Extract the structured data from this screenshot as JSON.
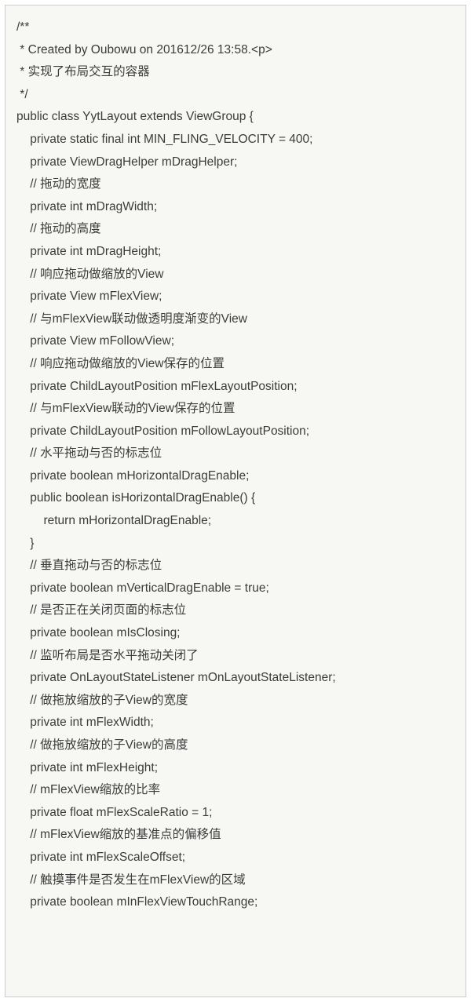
{
  "code": {
    "lines": [
      "/**",
      " * Created by Oubowu on 201612/26 13:58.<p>",
      " * 实现了布局交互的容器",
      " */",
      "public class YytLayout extends ViewGroup {",
      "    private static final int MIN_FLING_VELOCITY = 400;",
      "    private ViewDragHelper mDragHelper;",
      "    // 拖动的宽度",
      "    private int mDragWidth;",
      "    // 拖动的高度",
      "    private int mDragHeight;",
      "    // 响应拖动做缩放的View",
      "    private View mFlexView;",
      "    // 与mFlexView联动做透明度渐变的View",
      "    private View mFollowView;",
      "    // 响应拖动做缩放的View保存的位置",
      "    private ChildLayoutPosition mFlexLayoutPosition;",
      "    // 与mFlexView联动的View保存的位置",
      "    private ChildLayoutPosition mFollowLayoutPosition;",
      "    // 水平拖动与否的标志位",
      "    private boolean mHorizontalDragEnable;",
      "    public boolean isHorizontalDragEnable() {",
      "        return mHorizontalDragEnable;",
      "    }",
      "    // 垂直拖动与否的标志位",
      "    private boolean mVerticalDragEnable = true;",
      "    // 是否正在关闭页面的标志位",
      "    private boolean mIsClosing;",
      "    // 监听布局是否水平拖动关闭了",
      "    private OnLayoutStateListener mOnLayoutStateListener;",
      "    // 做拖放缩放的子View的宽度",
      "    private int mFlexWidth;",
      "    // 做拖放缩放的子View的高度",
      "    private int mFlexHeight;",
      "    // mFlexView缩放的比率",
      "    private float mFlexScaleRatio = 1;",
      "    // mFlexView缩放的基准点的偏移值",
      "    private int mFlexScaleOffset;",
      "    // 触摸事件是否发生在mFlexView的区域",
      "    private boolean mInFlexViewTouchRange;"
    ]
  }
}
